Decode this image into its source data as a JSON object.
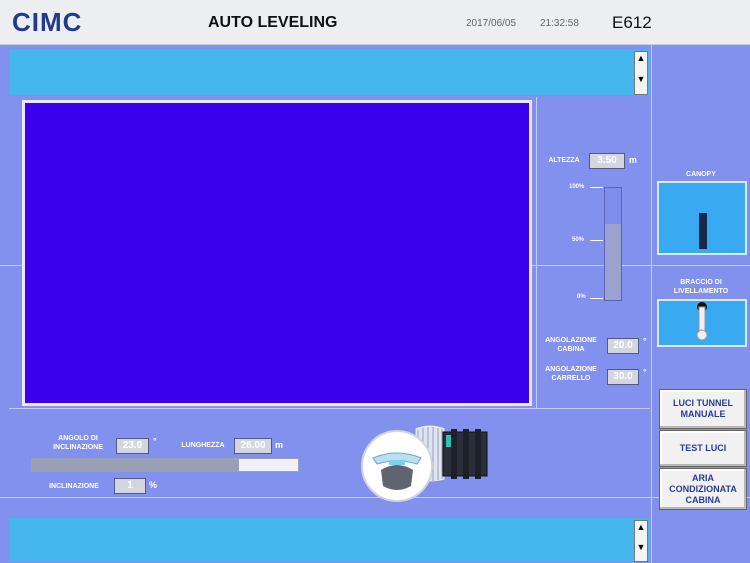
{
  "header": {
    "brand": "CIMC",
    "title": "AUTO LEVELING",
    "date": "2017/06/05",
    "time": "21:32:58",
    "code": "E612"
  },
  "scroll_icons": {
    "up": "▲",
    "down": "▼"
  },
  "gauge": {
    "altezza_label": "ALTEZZA",
    "altezza_value": "3.50",
    "altezza_unit": "m",
    "ticks": [
      "100%",
      "50%",
      "0%"
    ],
    "fill_fraction": 0.68
  },
  "angles": {
    "cabina_label_1": "ANGOLAZIONE",
    "cabina_label_2": "CABINA",
    "cabina_value": "20.0",
    "carrello_label_1": "ANGOLAZIONE",
    "carrello_label_2": "CARRELLO",
    "carrello_value": "30.0",
    "unit": "°"
  },
  "bottom": {
    "angolo_label_1": "ANGOLO DI",
    "angolo_label_2": "INCLINAZIONE",
    "angolo_value": "23.0",
    "angolo_unit": "°",
    "lunghezza_label": "LUNGHEZZA",
    "lunghezza_value": "26.00",
    "lunghezza_unit": "m",
    "inclinazione_label": "INCLINAZIONE",
    "inclinazione_value": "1",
    "inclinazione_unit": "%",
    "bar_fraction": 0.78
  },
  "right_panel": {
    "canopy_label": "CANOPY",
    "braccio_label_1": "BRACCIO DI",
    "braccio_label_2": "LIVELLAMENTO",
    "btn_luci_tunnel_1": "LUCI TUNNEL",
    "btn_luci_tunnel_2": "MANUALE",
    "btn_test_luci": "TEST LUCI",
    "btn_aria_1": "ARIA",
    "btn_aria_2": "CONDIZIONATA",
    "btn_aria_3": "CABINA"
  },
  "colors": {
    "main_display": "#3a00ee",
    "background": "#8290ee",
    "banner": "#45b6ee",
    "brand": "#1f3c8c"
  }
}
